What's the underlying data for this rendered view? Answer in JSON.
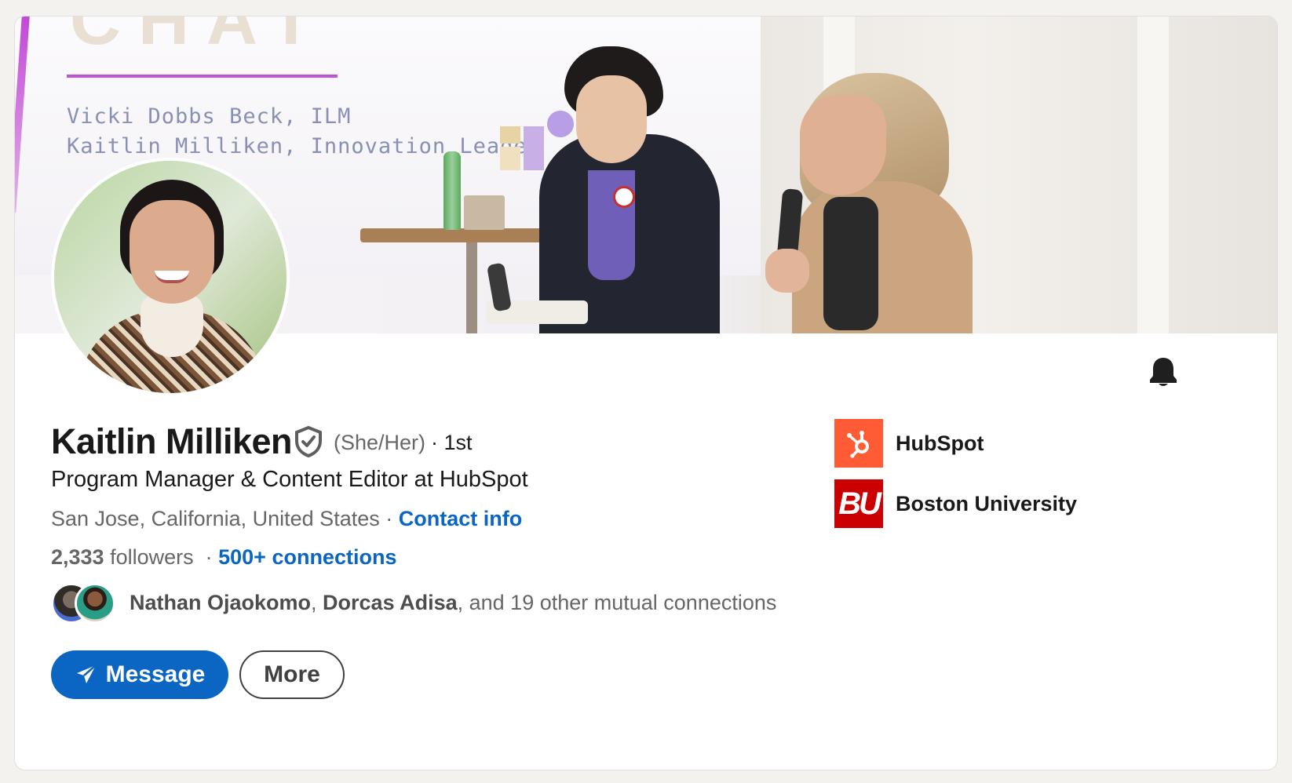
{
  "cover": {
    "screen_big_text": "CHAT",
    "screen_line_1": "Vicki Dobbs Beck, ILM",
    "screen_line_2": "Kaitlin Milliken, Innovation Leader"
  },
  "profile": {
    "name": "Kaitlin Milliken",
    "pronouns": "(She/Her)",
    "degree": "· 1st",
    "headline": "Program Manager & Content Editor at HubSpot",
    "location": "San Jose, California, United States",
    "location_separator": " · ",
    "contact_info_label": "Contact info",
    "followers_count": "2,333",
    "followers_label": " followers",
    "connections_separator": "  · ",
    "connections_label": "500+ connections",
    "mutual": {
      "name_1": "Nathan Ojaokomo",
      "separator": ", ",
      "name_2": "Dorcas Adisa",
      "rest": ", and 19 other mutual connections"
    }
  },
  "actions": {
    "message_label": "Message",
    "more_label": "More"
  },
  "organizations": [
    {
      "name": "HubSpot",
      "logo_text": ""
    },
    {
      "name": "Boston University",
      "logo_text": "BU"
    }
  ],
  "icons": {
    "verified": "shield-check-icon",
    "bell": "bell-icon",
    "send": "paper-plane-icon",
    "hubspot": "hubspot-sprocket-icon"
  },
  "colors": {
    "brand_blue": "#0a66c2",
    "hubspot_orange": "#ff5c35",
    "bu_red": "#cc0000"
  }
}
